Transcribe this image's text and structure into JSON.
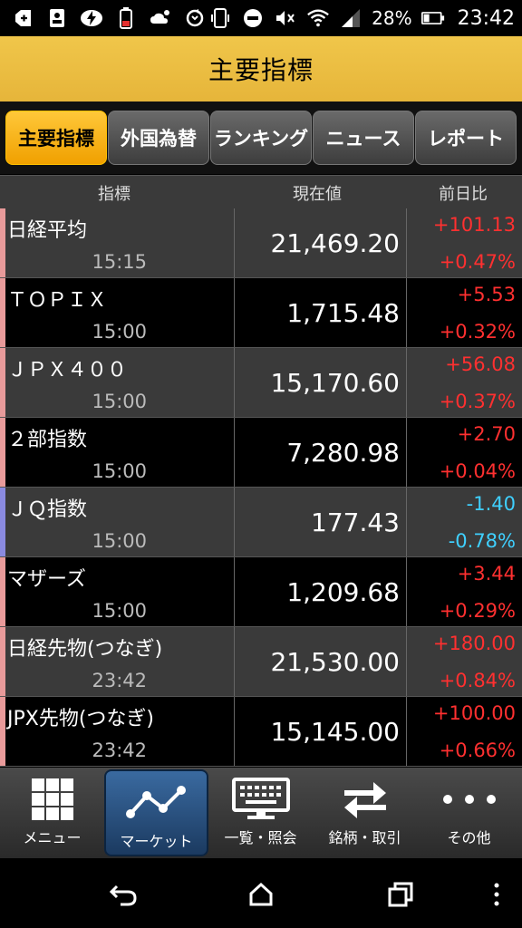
{
  "status_bar": {
    "battery_percent": "28%",
    "time": "23:42",
    "icons": [
      "plus-box-icon",
      "contact-card-icon",
      "lightning-icon",
      "battery-alert-icon",
      "weather-icon",
      "sync-icon",
      "phone-vibrate-icon",
      "dnd-icon",
      "mute-icon",
      "wifi-icon",
      "signal-icon",
      "battery-icon"
    ]
  },
  "header": {
    "title": "主要指標"
  },
  "tabs": [
    {
      "label": "主要指標",
      "active": true
    },
    {
      "label": "外国為替",
      "active": false
    },
    {
      "label": "ランキング",
      "active": false
    },
    {
      "label": "ニュース",
      "active": false
    },
    {
      "label": "レポート",
      "active": false
    }
  ],
  "columns": {
    "name": "指標",
    "value": "現在値",
    "change": "前日比"
  },
  "rows": [
    {
      "name": "日経平均",
      "time": "15:15",
      "value": "21,469.20",
      "chg": "+101.13",
      "pct": "+0.47%",
      "dir": "up"
    },
    {
      "name": "ＴＯＰＩＸ",
      "time": "15:00",
      "value": "1,715.48",
      "chg": "+5.53",
      "pct": "+0.32%",
      "dir": "up"
    },
    {
      "name": "ＪＰＸ４００",
      "time": "15:00",
      "value": "15,170.60",
      "chg": "+56.08",
      "pct": "+0.37%",
      "dir": "up"
    },
    {
      "name": "２部指数",
      "time": "15:00",
      "value": "7,280.98",
      "chg": "+2.70",
      "pct": "+0.04%",
      "dir": "up"
    },
    {
      "name": "ＪＱ指数",
      "time": "15:00",
      "value": "177.43",
      "chg": "-1.40",
      "pct": "-0.78%",
      "dir": "down"
    },
    {
      "name": "マザーズ",
      "time": "15:00",
      "value": "1,209.68",
      "chg": "+3.44",
      "pct": "+0.29%",
      "dir": "up"
    },
    {
      "name": "日経先物(つなぎ)",
      "time": "23:42",
      "value": "21,530.00",
      "chg": "+180.00",
      "pct": "+0.84%",
      "dir": "up"
    },
    {
      "name": "JPX先物(つなぎ)",
      "time": "23:42",
      "value": "15,145.00",
      "chg": "+100.00",
      "pct": "+0.66%",
      "dir": "up"
    }
  ],
  "bottom_nav": [
    {
      "label": "メニュー",
      "icon": "grid-icon",
      "active": false
    },
    {
      "label": "マーケット",
      "icon": "chart-line-icon",
      "active": true
    },
    {
      "label": "一覧・照会",
      "icon": "monitor-keyboard-icon",
      "active": false
    },
    {
      "label": "銘柄・取引",
      "icon": "swap-arrows-icon",
      "active": false
    },
    {
      "label": "その他",
      "icon": "more-dots-icon",
      "active": false
    }
  ],
  "colors": {
    "accent": "#f0b400",
    "up": "#ff3030",
    "down": "#3fd0ff",
    "title_bar": "#e8ba40"
  }
}
